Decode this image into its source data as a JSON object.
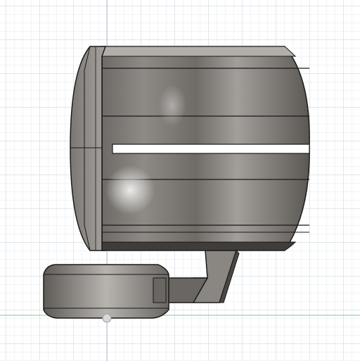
{
  "canvas": {
    "background": "#ffffff",
    "grid_minor_color": "#f1f3f5",
    "grid_major_color": "#e2e6ea",
    "axis_green_color": "#7fd18e",
    "axis_purple_color": "#c9b8d8"
  },
  "model": {
    "view": "side-orthographic",
    "material_colors": {
      "dark": "#55524f",
      "mid": "#8d8984",
      "light": "#c7c3be",
      "edge": "#1a1a1a"
    },
    "parts": [
      "cylinder-body",
      "end-cap",
      "slot",
      "mounting-arm",
      "base-disk"
    ]
  }
}
